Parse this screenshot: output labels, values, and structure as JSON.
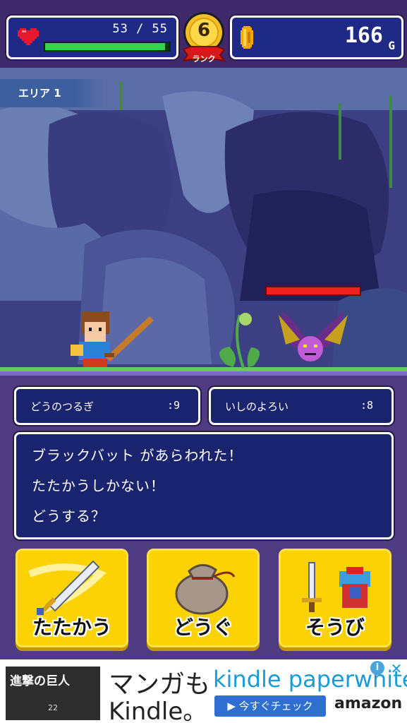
{
  "hud": {
    "hp_text": "53 / 55",
    "hp_current": 53,
    "hp_max": 55,
    "rank_value": "6",
    "rank_label": "ランク",
    "gold_value": "166",
    "gold_unit": "G",
    "colors": {
      "hp_bar": "#2fd64b",
      "panel": "#1f2a86",
      "medal": "#f2c024",
      "ribbon": "#d41a1a"
    }
  },
  "scene": {
    "area_label": "エリア 1",
    "enemy_hp_fraction": 1.0,
    "icons": [
      "hero-sprite",
      "black-bat-sprite",
      "sprout-plant-sprite"
    ]
  },
  "equipment": {
    "weapon": {
      "name": "どうのつるぎ",
      "value": ":9"
    },
    "armor": {
      "name": "いしのよろい",
      "value": ":8"
    }
  },
  "message": {
    "lines": [
      "ブラックバット があらわれた！",
      "たたかうしかない！",
      "どうする？"
    ]
  },
  "actions": {
    "fight": "たたかう",
    "item": "どうぐ",
    "equip": "そうび"
  },
  "ad": {
    "thumb_title": "進撃の巨人",
    "thumb_volume": "22",
    "manga_line": "マンガも",
    "kindle_line": "Kindle。",
    "product": "kindle paperwhite",
    "cta": "▶ 今すぐチェック",
    "brand": "amazon",
    "info_icon": "i",
    "close_icon": "✕"
  }
}
